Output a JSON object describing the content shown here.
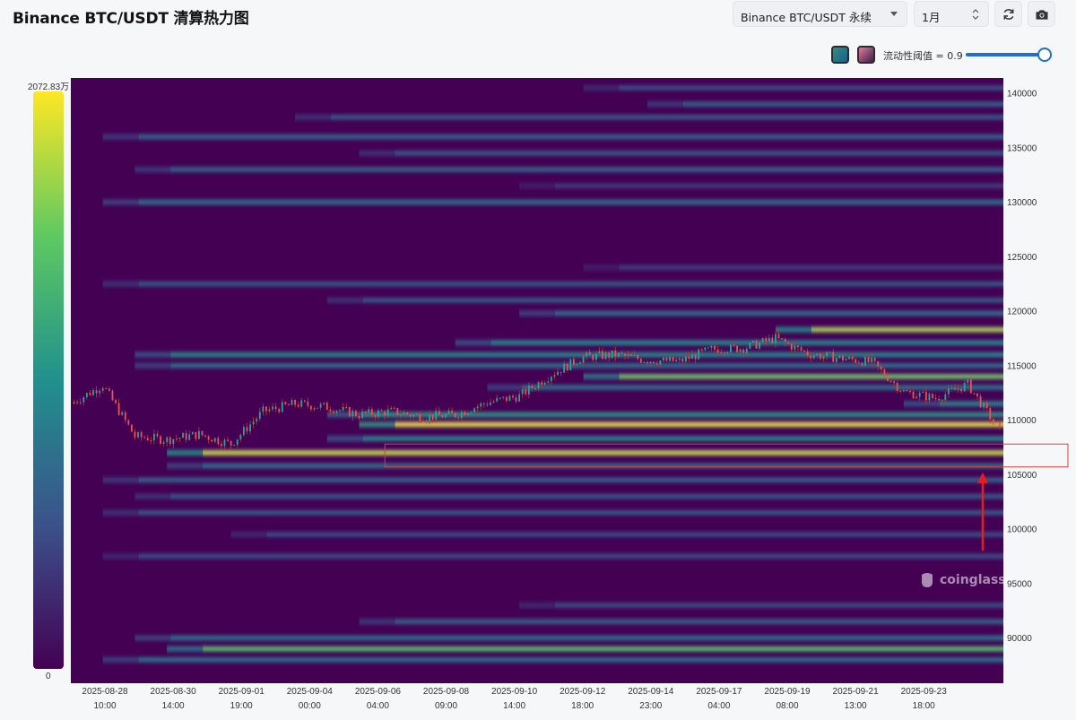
{
  "header": {
    "title": "Binance BTC/USDT 清算热力图",
    "symbol_select": "Binance BTC/USDT 永续",
    "range_select": "1月",
    "refresh_icon": "refresh-icon",
    "camera_icon": "camera-icon"
  },
  "legend": {
    "threshold_label": "流动性阈值 = 0.9",
    "threshold_value": 0.9,
    "colorbar_max": "2072.83万",
    "colorbar_min": "0",
    "colors": [
      "#440154",
      "#3b528b",
      "#21908d",
      "#5ec962",
      "#fde725"
    ]
  },
  "watermark": "coinglass",
  "chart_data": {
    "type": "heatmap",
    "title": "",
    "xlabel": "",
    "ylabel": "",
    "ylim": [
      86500,
      141500
    ],
    "y_ticks": [
      90000,
      95000,
      100000,
      105000,
      110000,
      115000,
      120000,
      125000,
      130000,
      135000,
      140000
    ],
    "y_tick_labels": [
      "90000",
      "95000",
      "100000",
      "105000",
      "110000",
      "115000",
      "120000",
      "125000",
      "130000",
      "135000",
      "140000"
    ],
    "x_ticks": [
      {
        "date": "2025-08-28",
        "time": "10:00"
      },
      {
        "date": "2025-08-30",
        "time": "14:00"
      },
      {
        "date": "2025-09-01",
        "time": "19:00"
      },
      {
        "date": "2025-09-04",
        "time": "00:00"
      },
      {
        "date": "2025-09-06",
        "time": "04:00"
      },
      {
        "date": "2025-09-08",
        "time": "09:00"
      },
      {
        "date": "2025-09-10",
        "time": "14:00"
      },
      {
        "date": "2025-09-12",
        "time": "18:00"
      },
      {
        "date": "2025-09-14",
        "time": "23:00"
      },
      {
        "date": "2025-09-17",
        "time": "04:00"
      },
      {
        "date": "2025-09-19",
        "time": "08:00"
      },
      {
        "date": "2025-09-21",
        "time": "13:00"
      },
      {
        "date": "2025-09-23",
        "time": "18:00"
      }
    ],
    "price_series": [
      {
        "t": "2025-08-27",
        "price": 111500
      },
      {
        "t": "2025-08-28",
        "price": 113200
      },
      {
        "t": "2025-08-29",
        "price": 108500
      },
      {
        "t": "2025-08-30",
        "price": 108200
      },
      {
        "t": "2025-08-31",
        "price": 108700
      },
      {
        "t": "2025-09-01",
        "price": 107800
      },
      {
        "t": "2025-09-02",
        "price": 110800
      },
      {
        "t": "2025-09-03",
        "price": 111500
      },
      {
        "t": "2025-09-04",
        "price": 111200
      },
      {
        "t": "2025-09-05",
        "price": 110500
      },
      {
        "t": "2025-09-06",
        "price": 110800
      },
      {
        "t": "2025-09-07",
        "price": 110300
      },
      {
        "t": "2025-09-08",
        "price": 110500
      },
      {
        "t": "2025-09-09",
        "price": 111600
      },
      {
        "t": "2025-09-10",
        "price": 112200
      },
      {
        "t": "2025-09-11",
        "price": 114200
      },
      {
        "t": "2025-09-12",
        "price": 115800
      },
      {
        "t": "2025-09-13",
        "price": 116000
      },
      {
        "t": "2025-09-14",
        "price": 115500
      },
      {
        "t": "2025-09-15",
        "price": 115400
      },
      {
        "t": "2025-09-16",
        "price": 116500
      },
      {
        "t": "2025-09-17",
        "price": 116600
      },
      {
        "t": "2025-09-18",
        "price": 117500
      },
      {
        "t": "2025-09-19",
        "price": 116100
      },
      {
        "t": "2025-09-20",
        "price": 115700
      },
      {
        "t": "2025-09-21",
        "price": 115300
      },
      {
        "t": "2025-09-22",
        "price": 112600
      },
      {
        "t": "2025-09-23",
        "price": 112000
      },
      {
        "t": "2025-09-24",
        "price": 113300
      },
      {
        "t": "2025-09-25",
        "price": 109000
      }
    ],
    "liquidity_bands": [
      {
        "price": 140500,
        "intensity": 0.25,
        "start": "2025-09-12"
      },
      {
        "price": 139000,
        "intensity": 0.35,
        "start": "2025-09-14"
      },
      {
        "price": 137800,
        "intensity": 0.3,
        "start": "2025-09-03"
      },
      {
        "price": 136000,
        "intensity": 0.35,
        "start": "2025-08-28"
      },
      {
        "price": 134500,
        "intensity": 0.3,
        "start": "2025-09-05"
      },
      {
        "price": 133000,
        "intensity": 0.35,
        "start": "2025-08-29"
      },
      {
        "price": 131500,
        "intensity": 0.2,
        "start": "2025-09-10"
      },
      {
        "price": 130000,
        "intensity": 0.4,
        "start": "2025-08-28"
      },
      {
        "price": 124000,
        "intensity": 0.2,
        "start": "2025-09-12"
      },
      {
        "price": 122500,
        "intensity": 0.3,
        "start": "2025-08-28"
      },
      {
        "price": 121000,
        "intensity": 0.3,
        "start": "2025-09-04"
      },
      {
        "price": 119800,
        "intensity": 0.4,
        "start": "2025-09-10"
      },
      {
        "price": 118300,
        "intensity": 0.9,
        "start": "2025-09-18"
      },
      {
        "price": 117100,
        "intensity": 0.5,
        "start": "2025-09-08"
      },
      {
        "price": 116000,
        "intensity": 0.5,
        "start": "2025-08-29"
      },
      {
        "price": 115000,
        "intensity": 0.4,
        "start": "2025-08-29"
      },
      {
        "price": 114000,
        "intensity": 0.8,
        "start": "2025-09-12"
      },
      {
        "price": 113000,
        "intensity": 0.4,
        "start": "2025-09-09"
      },
      {
        "price": 111500,
        "intensity": 0.5,
        "start": "2025-09-22"
      },
      {
        "price": 110500,
        "intensity": 0.55,
        "start": "2025-09-04"
      },
      {
        "price": 109600,
        "intensity": 1.0,
        "start": "2025-09-05"
      },
      {
        "price": 108300,
        "intensity": 0.5,
        "start": "2025-09-04"
      },
      {
        "price": 107000,
        "intensity": 0.95,
        "start": "2025-08-30"
      },
      {
        "price": 105800,
        "intensity": 0.4,
        "start": "2025-08-30"
      },
      {
        "price": 104500,
        "intensity": 0.35,
        "start": "2025-08-28"
      },
      {
        "price": 103000,
        "intensity": 0.3,
        "start": "2025-08-29"
      },
      {
        "price": 101500,
        "intensity": 0.3,
        "start": "2025-08-28"
      },
      {
        "price": 99500,
        "intensity": 0.25,
        "start": "2025-09-01"
      },
      {
        "price": 97500,
        "intensity": 0.25,
        "start": "2025-08-28"
      },
      {
        "price": 93000,
        "intensity": 0.25,
        "start": "2025-09-10"
      },
      {
        "price": 91500,
        "intensity": 0.35,
        "start": "2025-09-05"
      },
      {
        "price": 90000,
        "intensity": 0.4,
        "start": "2025-08-29"
      },
      {
        "price": 89000,
        "intensity": 0.75,
        "start": "2025-08-30"
      },
      {
        "price": 88000,
        "intensity": 0.4,
        "start": "2025-08-28"
      }
    ],
    "highlight_box": {
      "price_low": 105700,
      "price_high": 107800,
      "start": "2025-09-06",
      "end": "2025-09-25",
      "color": "#e03b3b"
    },
    "arrow": {
      "date": "2025-09-25",
      "from_price": 98000,
      "to_price": 105200,
      "color": "#e02020"
    }
  }
}
